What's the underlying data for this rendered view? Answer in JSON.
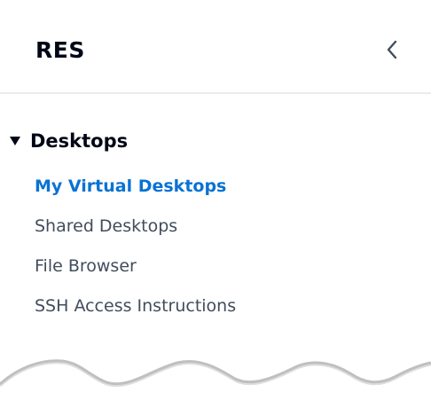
{
  "header": {
    "title": "RES",
    "collapse_icon": "chevron-left-icon"
  },
  "section": {
    "title": "Desktops",
    "expanded": true,
    "caret_icon": "caret-down-icon",
    "items": [
      {
        "label": "My Virtual Desktops",
        "active": true
      },
      {
        "label": "Shared Desktops",
        "active": false
      },
      {
        "label": "File Browser",
        "active": false
      },
      {
        "label": "SSH Access Instructions",
        "active": false
      }
    ]
  },
  "colors": {
    "active_link": "#0972d3",
    "text": "#414d5c",
    "heading": "#000716",
    "divider": "#e9ebed"
  }
}
